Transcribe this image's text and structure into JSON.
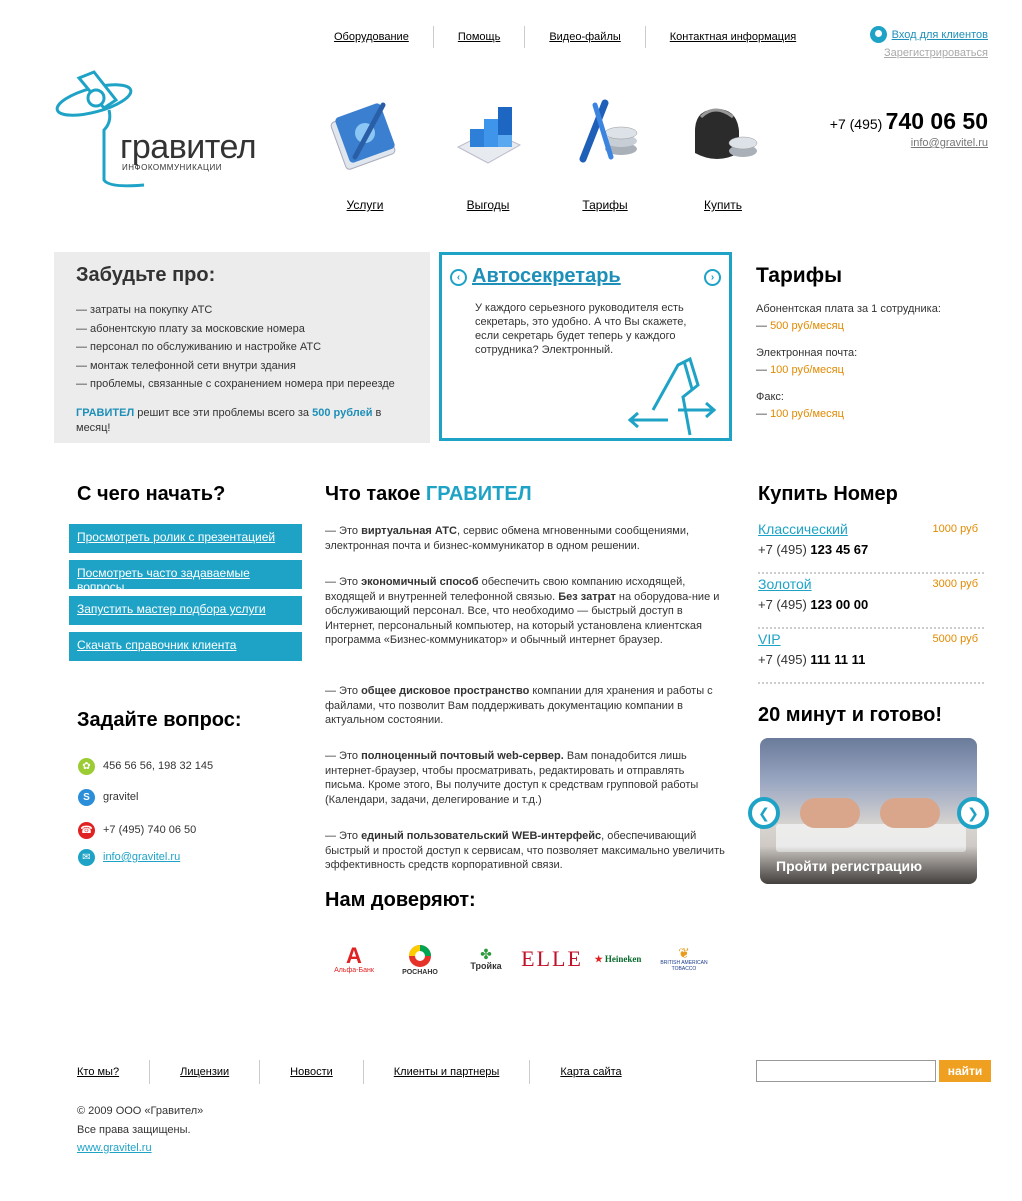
{
  "topnav": [
    "Оборудование",
    "Помощь",
    "Видео-файлы",
    "Контактная информация"
  ],
  "login": {
    "enter": "Вход для клиентов",
    "register": "Зарегистрироваться"
  },
  "logo": {
    "brand": "гравител",
    "tagline": "ИНФОКОММУНИКАЦИИ"
  },
  "services": [
    "Услуги",
    "Выгоды",
    "Тарифы",
    "Купить"
  ],
  "contact_header": {
    "prefix": "+7 (495)",
    "number": "740 06 50",
    "email": "info@gravitel.ru"
  },
  "forget": {
    "title": "Забудьте про:",
    "items": [
      "— затраты на покупку АТС",
      "— абонентскую плату за московские номера",
      "— персонал по обслуживанию и настройке АТС",
      "— монтаж телефонной сети внутри здания",
      "— проблемы, связанные с сохранением номера при переезде"
    ],
    "note_brand": "ГРАВИТЕЛ",
    "note_mid": " решит все эти проблемы всего за ",
    "note_price": "500 рублей",
    "note_end": " в месяц!"
  },
  "autosecretary": {
    "title": "Автосекретарь",
    "text": "У каждого серьезного руководителя есть секретарь, это удобно. А что Вы скажете, если секретарь будет теперь у каждого сотрудника? Электронный."
  },
  "tariffs": {
    "title": "Тарифы",
    "items": [
      {
        "label": "Абонентская плата за 1 сотрудника:",
        "price": "500 руб/месяц"
      },
      {
        "label": "Электронная почта:",
        "price": "100 руб/месяц"
      },
      {
        "label": "Факс:",
        "price": "100 руб/месяц"
      }
    ]
  },
  "start": {
    "title": "С чего начать?",
    "buttons": [
      "Просмотреть ролик с презентацией",
      "Посмотреть часто задаваемые вопросы",
      "Запустить мастер подбора услуги",
      "Скачать справочник клиента"
    ]
  },
  "ask": {
    "title": "Задайте вопрос:",
    "icq": "456 56 56, 198 32 145",
    "skype": "gravitel",
    "phone": "+7 (495) 740 06 50",
    "email": "info@gravitel.ru"
  },
  "what": {
    "title_a": "Что такое ",
    "title_b": "ГРАВИТЕЛ",
    "paragraphs": [
      [
        "— Это ",
        "виртуальная АТС",
        ",  сервис обмена мгновенными сообщениями, электронная почта и бизнес-коммуникатор в одном решении."
      ],
      [
        "— Это ",
        "экономичный способ",
        " обеспечить свою компанию исходящей, входящей и внутренней телефонной связью. ",
        "Без затрат",
        " на оборудова-ние и обслуживающий персонал. Все, что необходимо  — быстрый доступ в Интернет, персональный компьютер, на который установлена клиентская программа «Бизнес-коммуникатор» и обычный интернет браузер."
      ],
      [
        "— Это ",
        "общее дисковое пространство",
        " компании для хранения и работы с файлами, что позволит Вам поддерживать документацию компании в актуальном  состоянии."
      ],
      [
        "— Это ",
        "полноценный почтовый web-сервер.",
        " Вам понадобится лишь интернет-браузер, чтобы просматривать, редактировать и отправлять письма. Кроме этого, Вы получите доступ к средствам групповой работы (Календари, задачи, делегирование и т.д.)"
      ],
      [
        "— Это ",
        "единый пользовательский WEB-интерфейс",
        ", обеспечивающий быстрый и простой доступ к сервисам, что позволяет максимально увеличить эффективность средств корпоративной связи."
      ]
    ]
  },
  "trust": {
    "title": "Нам доверяют:",
    "logos": [
      "Альфа-Банк",
      "РОСНАНО",
      "Тройка",
      "ELLE",
      "Heineken",
      "BRITISH AMERICAN TOBACCO"
    ]
  },
  "buy": {
    "title": "Купить Номер",
    "items": [
      {
        "name": "Классический",
        "price": "1000 руб",
        "prefix": "+7 (495) ",
        "num": "123 45 67"
      },
      {
        "name": "Золотой",
        "price": "3000 руб",
        "prefix": "+7 (495) ",
        "num": "123 00 00"
      },
      {
        "name": "VIP",
        "price": "5000 руб",
        "prefix": "+7 (495) ",
        "num": "111 11 11"
      }
    ]
  },
  "promo": {
    "title": "20 минут и готово!",
    "caption": "Пройти регистрацию"
  },
  "footer": {
    "nav": [
      "Кто мы?",
      "Лицензии",
      "Новости",
      "Клиенты и партнеры",
      "Карта сайта"
    ],
    "search_button": "найти",
    "copyright": "© 2009 ООО «Гравител»",
    "rights": "Все права защищены.",
    "site": "www.gravitel.ru"
  },
  "colors": {
    "accent": "#1ea3c7",
    "orange": "#e08a00",
    "button": "#f0a020"
  }
}
